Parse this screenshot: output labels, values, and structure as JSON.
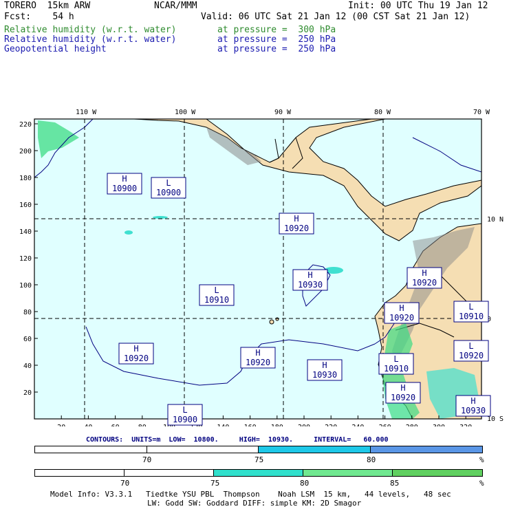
{
  "header": {
    "model": "TORERO  15km ARW",
    "center": "NCAR/MMM",
    "init": "Init: 00 UTC Thu 19 Jan 12",
    "fcst": "Fcst:    54 h",
    "valid": "Valid: 06 UTC Sat 21 Jan 12 (00 CST Sat 21 Jan 12)",
    "fields": [
      {
        "label": "Relative humidity (w.r.t. water)",
        "level": "at pressure =  300 hPa",
        "color": "#2e8b2e"
      },
      {
        "label": "Relative humidity (w.r.t. water)",
        "level": "at pressure =  250 hPa",
        "color": "#1c1cb0"
      },
      {
        "label": "Geopotential height",
        "level": "at pressure =  250 hPa",
        "color": "#1c1cb0"
      }
    ]
  },
  "map": {
    "top_lon_labels": [
      "110 W",
      "100 W",
      "90 W",
      "80 W",
      "70 W"
    ],
    "right_lat_labels": [
      "10 N",
      "0",
      "10 S"
    ],
    "x_ticks": [
      "20",
      "40",
      "60",
      "80",
      "100",
      "120",
      "140",
      "160",
      "180",
      "200",
      "220",
      "240",
      "260",
      "280",
      "300",
      "320"
    ],
    "y_ticks": [
      "220",
      "200",
      "180",
      "160",
      "140",
      "120",
      "100",
      "80",
      "60",
      "40",
      "20"
    ],
    "pressure_centers": [
      {
        "type": "H",
        "value": "10900"
      },
      {
        "type": "L",
        "value": "10900"
      },
      {
        "type": "H",
        "value": "10920"
      },
      {
        "type": "H",
        "value": "10930"
      },
      {
        "type": "L",
        "value": "10910"
      },
      {
        "type": "H",
        "value": "10920"
      },
      {
        "type": "H",
        "value": "10920"
      },
      {
        "type": "H",
        "value": "10930"
      },
      {
        "type": "H",
        "value": "10920"
      },
      {
        "type": "H",
        "value": "10920"
      },
      {
        "type": "L",
        "value": "10910"
      },
      {
        "type": "H",
        "value": "10920"
      },
      {
        "type": "L",
        "value": "10910"
      },
      {
        "type": "L",
        "value": "10920"
      },
      {
        "type": "H",
        "value": "10930"
      },
      {
        "type": "L",
        "value": "10900"
      }
    ],
    "colors": {
      "ocean": "#e0ffff",
      "land": "#f5deb3",
      "mountain": "#8a8a8a",
      "coast": "#000000",
      "contour": "#000080",
      "rh_green": "#3ddc84",
      "rh_cyan": "#40e0d0"
    }
  },
  "contours": "CONTOURS:  UNITS=m  LOW=  10800.     HIGH=  10930.     INTERVAL=   60.000",
  "colorbars": [
    {
      "labels": [
        "70",
        "75",
        "80",
        "%"
      ],
      "segments": [
        "#ffffff",
        "#ffffff",
        "#1ec8e8",
        "#5a96e6"
      ]
    },
    {
      "labels": [
        "70",
        "75",
        "80",
        "85",
        "%"
      ],
      "segments": [
        "#ffffff",
        "#ffffff",
        "#30e0cc",
        "#70e890",
        "#60d060"
      ]
    }
  ],
  "footer": {
    "line1": "Model Info: V3.3.1   Tiedtke YSU PBL  Thompson    Noah LSM  15 km,   44 levels,   48 sec",
    "line2": "LW: Godd SW: Goddard DIFF: simple KM: 2D Smagor"
  }
}
